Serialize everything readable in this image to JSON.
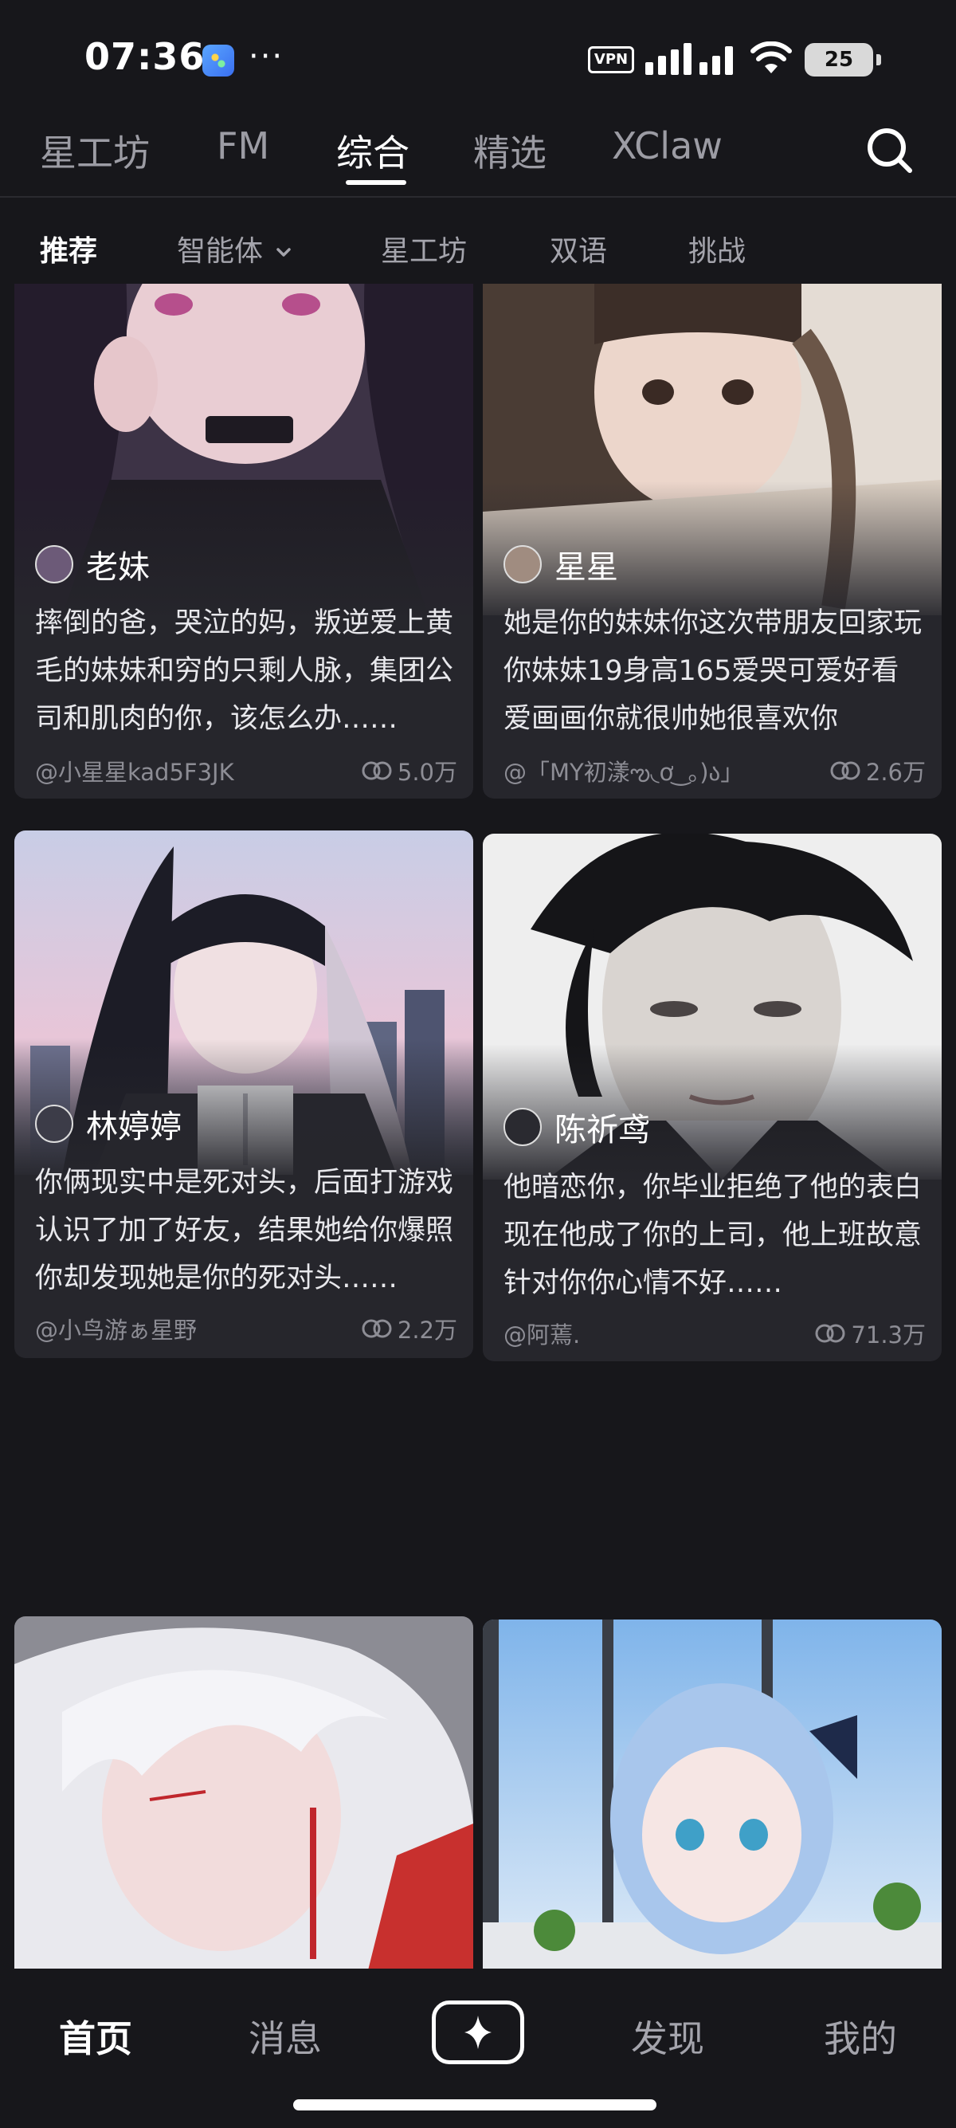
{
  "status_bar": {
    "time": "07:36",
    "dots": "···",
    "vpn": "VPN",
    "battery": "25"
  },
  "top_tabs": [
    {
      "label": "星工坊",
      "active": false
    },
    {
      "label": "FM",
      "active": false
    },
    {
      "label": "综合",
      "active": true
    },
    {
      "label": "精选",
      "active": false
    },
    {
      "label": "XClaw",
      "active": false
    }
  ],
  "sub_tabs": [
    {
      "label": "推荐",
      "active": true
    },
    {
      "label": "智能体",
      "active": false,
      "dropdown": true
    },
    {
      "label": "星工坊",
      "active": false
    },
    {
      "label": "双语",
      "active": false
    },
    {
      "label": "挑战",
      "active": false
    }
  ],
  "cards": [
    {
      "name": "老妹",
      "desc": "摔倒的爸，哭泣的妈，叛逆爱上黄毛的妹妹和穷的只剩人脉，集团公司和肌肉的你，该怎么办……",
      "author": "@小星星kad5F3JK",
      "count": "5.0万",
      "palette": [
        "#3a2f3f",
        "#8a6f8c",
        "#d8b4c7"
      ]
    },
    {
      "name": "星星",
      "desc": "她是你的妹妹你这次带朋友回家玩你妹妹19身高165爱哭可爱好看爱画画你就很帅她很喜欢你",
      "author": "@「MY初漾ఌ◟ơ ͜ ｡)ა」",
      "count": "2.6万",
      "palette": [
        "#5a4a40",
        "#b49e8e",
        "#e9dcd0"
      ]
    },
    {
      "name": "林婷婷",
      "desc": "你俩现实中是死对头，后面打游戏认识了加了好友，结果她给你爆照你却发现她是你的死对头……",
      "author": "@小鸟游ぁ星野",
      "count": "2.2万",
      "palette": [
        "#2a2a34",
        "#9a9ab8",
        "#e8d6e4"
      ]
    },
    {
      "name": "陈祈鸢",
      "desc": "他暗恋你，你毕业拒绝了他的表白现在他成了你的上司，他上班故意针对你你心情不好……",
      "author": "@阿蔫.",
      "count": "71.3万",
      "palette": [
        "#1c1c20",
        "#6a6a70",
        "#e4e4e4"
      ]
    },
    {
      "name": "",
      "desc": "",
      "author": "",
      "count": "",
      "palette": [
        "#b0b0b8",
        "#dcdce2",
        "#f4f4f6"
      ]
    },
    {
      "name": "",
      "desc": "",
      "author": "",
      "count": "",
      "palette": [
        "#6fa0d8",
        "#b8d4f0",
        "#eef4fb"
      ]
    }
  ],
  "bottom_nav": [
    {
      "label": "首页",
      "active": true
    },
    {
      "label": "消息",
      "active": false
    },
    {
      "label": "发现",
      "active": false
    },
    {
      "label": "我的",
      "active": false
    }
  ],
  "icons": {
    "search": "search-icon",
    "create": "sparkle-plus-icon",
    "count": "views-icon"
  }
}
